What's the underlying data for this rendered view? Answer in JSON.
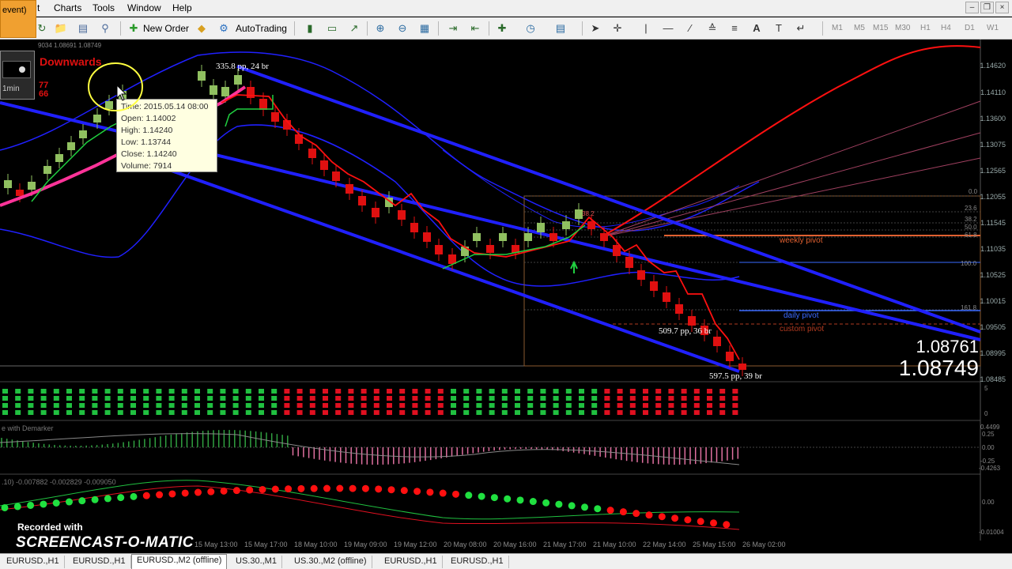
{
  "menu": {
    "overlay_text": "event)",
    "items": [
      "t",
      "Charts",
      "Tools",
      "Window",
      "Help"
    ]
  },
  "toolbar": {
    "new_order": "New Order",
    "autotrading": "AutoTrading",
    "timeframes": [
      "M1",
      "M5",
      "M15",
      "M30",
      "H1",
      "H4",
      "D1",
      "W1"
    ]
  },
  "recorder": {
    "label": "1min"
  },
  "chart": {
    "indicator_title": "Downwards",
    "header_small": "9034 1.08691 1.08749",
    "side_numbers": [
      "77",
      "66"
    ],
    "tooltip": {
      "time": "Time: 2015.05.14 08:00",
      "open": "Open: 1.14002",
      "high": "High: 1.14240",
      "low": "Low: 1.13744",
      "close": "Close: 1.14240",
      "volume": "Volume: 7914"
    },
    "wave_labels": {
      "top": "335.8 pp, 24 br",
      "mid": "509.7 pp, 36 br",
      "bottom": "597.5 pp, 39 br"
    },
    "pivot_labels": {
      "weekly": "weekly pivot",
      "daily": "daily pivot",
      "custom": "custom pivot"
    },
    "fib_levels": [
      "0.0",
      "23.6",
      "38.2",
      "50.0",
      "61.8",
      "100.0",
      "161.8"
    ],
    "fib_center": "38.2",
    "price_axis": [
      "1.14620",
      "1.14110",
      "1.13600",
      "1.13075",
      "1.12565",
      "1.12055",
      "1.11545",
      "1.11035",
      "1.10525",
      "1.10015",
      "1.09505",
      "1.08995",
      "1.08485"
    ],
    "bid_price": "1.08761",
    "ask_price": "1.08749",
    "time_axis": [
      "15 May 13:00",
      "15 May 17:00",
      "18 May 10:00",
      "19 May 09:00",
      "19 May 12:00",
      "20 May 08:00",
      "20 May 16:00",
      "21 May 17:00",
      "21 May 10:00",
      "22 May 14:00",
      "25 May 15:00",
      "26 May 02:00"
    ],
    "osc1_ticks": [
      "5",
      "0"
    ],
    "osc2_title": "e with Demarker",
    "osc2_ticks": [
      "0.4499",
      "0.25",
      "0.00",
      "-0.25",
      "-0.4263"
    ],
    "osc3_title": ".10) -0.007882 -0.002829 -0.009050",
    "osc3_ticks": [
      "0.00",
      "-0.01004"
    ],
    "colors": {
      "channel": "#2020ff",
      "up_candle": "#90c060",
      "down_candle": "#e01010",
      "red_line": "#ff1010",
      "pink_line": "#ff3399",
      "green": "#20d040"
    }
  },
  "tabs": [
    "EURUSD.,H1",
    "EURUSD.,H1",
    "EURUSD.,M2 (offline)",
    "US.30.,M1",
    "US.30.,M2 (offline)",
    "EURUSD.,H1",
    "EURUSD.,H1"
  ],
  "active_tab": 2,
  "watermark": {
    "recorded": "Recorded with",
    "brand": "SCREENCAST-O-MATIC"
  }
}
